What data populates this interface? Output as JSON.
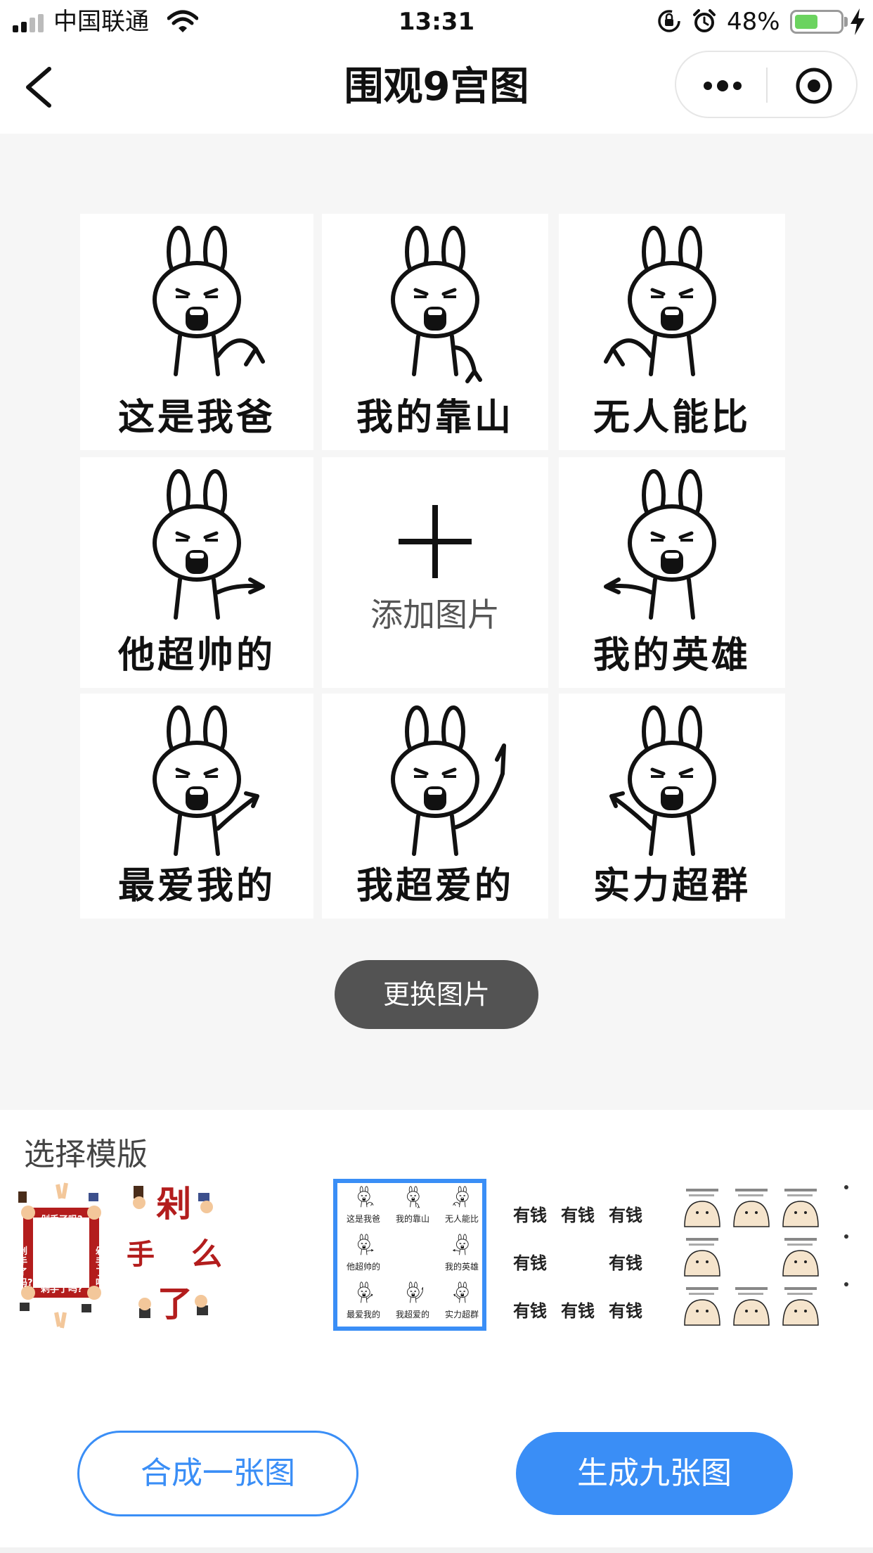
{
  "status_bar": {
    "carrier": "中国联通",
    "time": "13:31",
    "battery_percent": "48%",
    "battery_level": 0.48,
    "icons": [
      "signal-icon",
      "wifi-icon",
      "rotation-lock-icon",
      "alarm-icon",
      "battery-icon",
      "charging-icon"
    ]
  },
  "nav": {
    "title": "围观9宫图",
    "icons": [
      "back-chevron-icon",
      "more-dots-icon",
      "capsule-close-icon"
    ]
  },
  "grid": {
    "tiles": [
      {
        "caption": "这是我爸",
        "pose": "point-right-down"
      },
      {
        "caption": "我的靠山",
        "pose": "point-down"
      },
      {
        "caption": "无人能比",
        "pose": "point-left-down"
      },
      {
        "caption": "他超帅的",
        "pose": "point-right"
      },
      {
        "caption": "",
        "pose": "add"
      },
      {
        "caption": "我的英雄",
        "pose": "point-left"
      },
      {
        "caption": "最爱我的",
        "pose": "point-up-right"
      },
      {
        "caption": "我超爱的",
        "pose": "point-up"
      },
      {
        "caption": "实力超群",
        "pose": "point-up-left"
      }
    ],
    "add_label": "添加图片"
  },
  "swap_button": "更换图片",
  "templates": {
    "header": "选择模版",
    "items": [
      {
        "name": "剁手了吗",
        "small_text": [
          "剁手了吗?",
          "剁手了吗?",
          "剁手了吗?",
          "剁手了吗?"
        ]
      },
      {
        "name": "剁手了么",
        "big_chars": [
          "剁",
          "手",
          "么",
          "了"
        ]
      },
      {
        "name": "bunny-grid",
        "selected": true,
        "captions": [
          "这是我爸",
          "我的靠山",
          "无人能比",
          "他超帅的",
          "我的英雄",
          "最爱我的",
          "我超爱的",
          "实力超群"
        ]
      },
      {
        "name": "有钱",
        "word": "有钱"
      },
      {
        "name": "blob-grid"
      }
    ],
    "accent_color": "#3a8ef6"
  },
  "buttons": {
    "merge": "合成一张图",
    "generate": "生成九张图"
  },
  "colors": {
    "primary": "#3a8ef6",
    "dark_button": "#535353",
    "background": "#f6f6f6"
  }
}
